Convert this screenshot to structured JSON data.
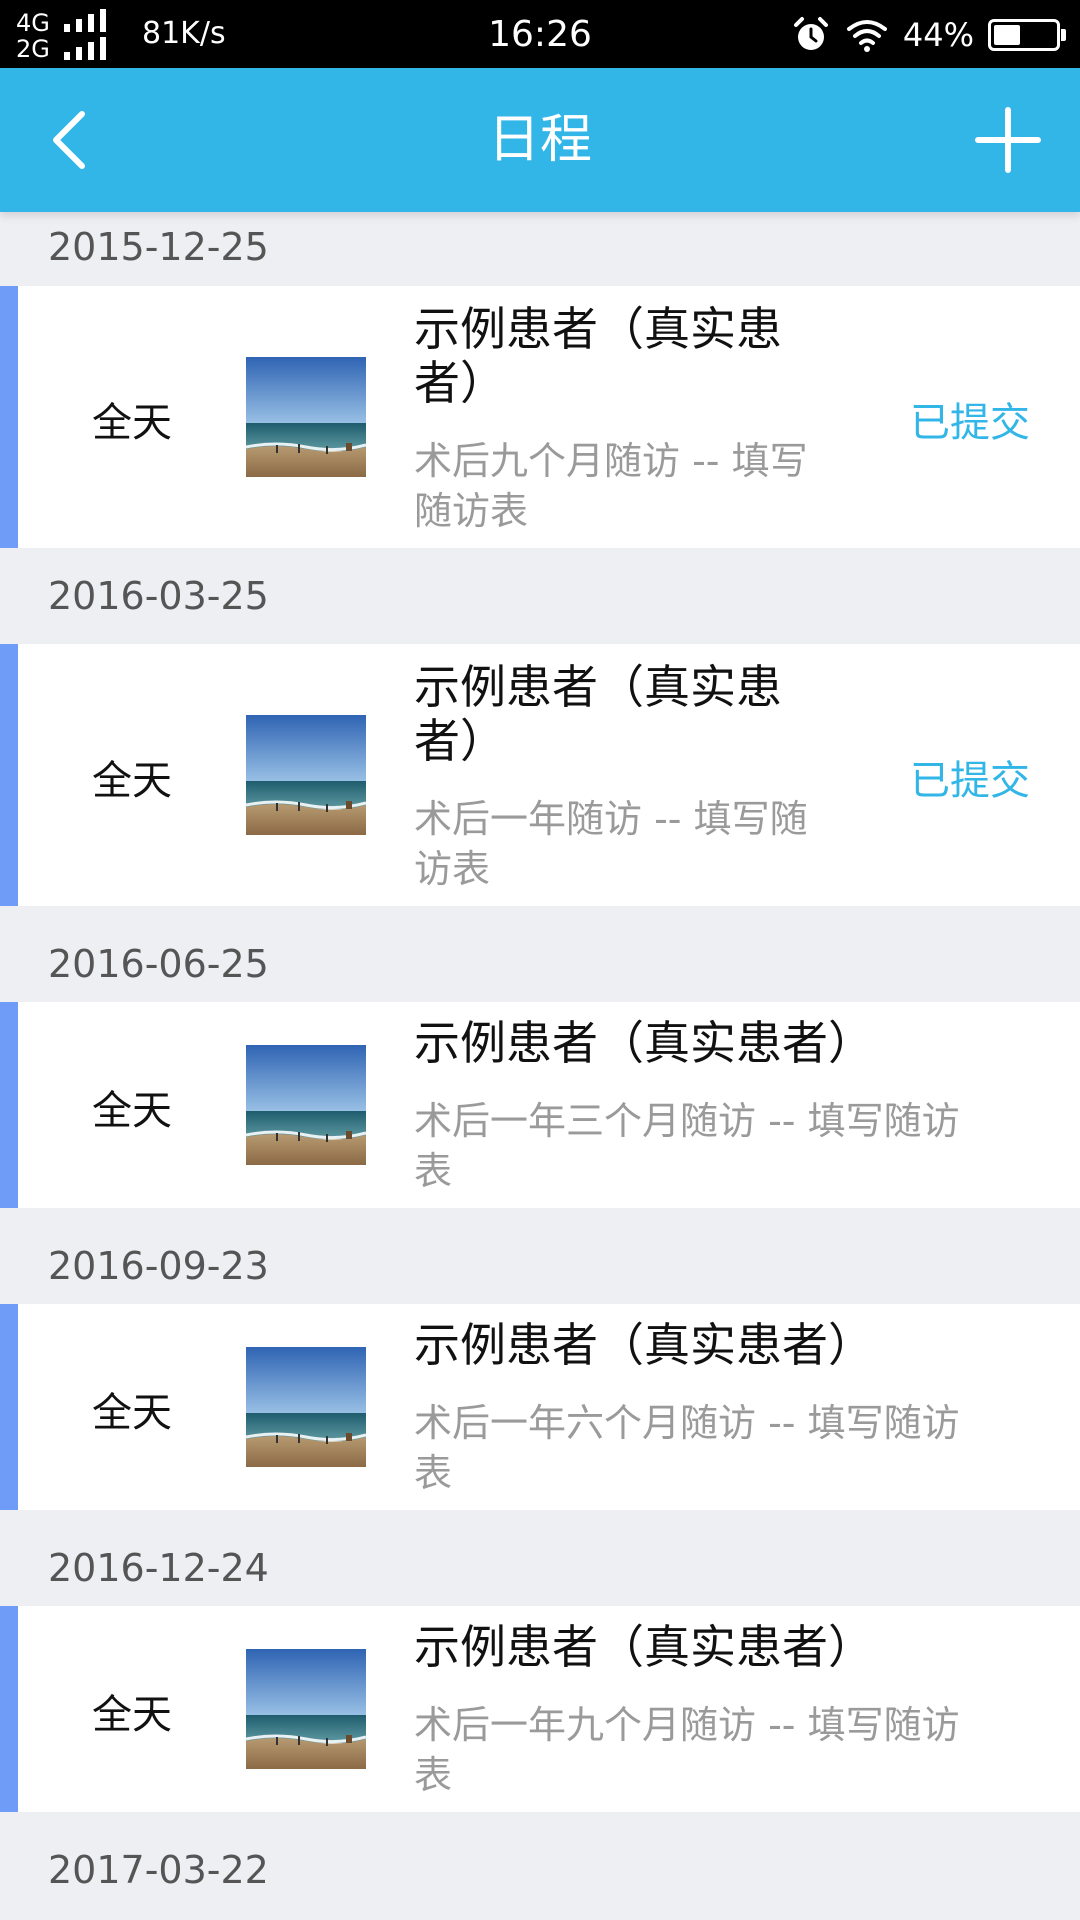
{
  "status_bar": {
    "network_top": "4G",
    "network_bottom": "2G",
    "speed": "81K/s",
    "time": "16:26",
    "battery_percent": "44%",
    "battery_level": 0.44,
    "icons": [
      "alarm-icon",
      "wifi-icon",
      "battery-icon"
    ]
  },
  "header": {
    "title": "日程",
    "back_icon": "chevron-left-icon",
    "add_icon": "plus-icon"
  },
  "colors": {
    "header_bg": "#31b6e7",
    "accent_bar": "#6f9cf6",
    "status_text": "#31b6e7",
    "page_bg": "#eeeff3"
  },
  "schedule": [
    {
      "date": "2015-12-25",
      "time_label": "全天",
      "patient": "示例患者（真实患者）",
      "description": "术后九个月随访 -- 填写随访表",
      "status": "已提交"
    },
    {
      "date": "2016-03-25",
      "time_label": "全天",
      "patient": "示例患者（真实患者）",
      "description": "术后一年随访 -- 填写随访表",
      "status": "已提交"
    },
    {
      "date": "2016-06-25",
      "time_label": "全天",
      "patient": "示例患者（真实患者）",
      "description": "术后一年三个月随访 -- 填写随访表",
      "status": ""
    },
    {
      "date": "2016-09-23",
      "time_label": "全天",
      "patient": "示例患者（真实患者）",
      "description": "术后一年六个月随访 -- 填写随访表",
      "status": ""
    },
    {
      "date": "2016-12-24",
      "time_label": "全天",
      "patient": "示例患者（真实患者）",
      "description": "术后一年九个月随访 -- 填写随访表",
      "status": ""
    },
    {
      "date": "2017-03-22"
    }
  ]
}
